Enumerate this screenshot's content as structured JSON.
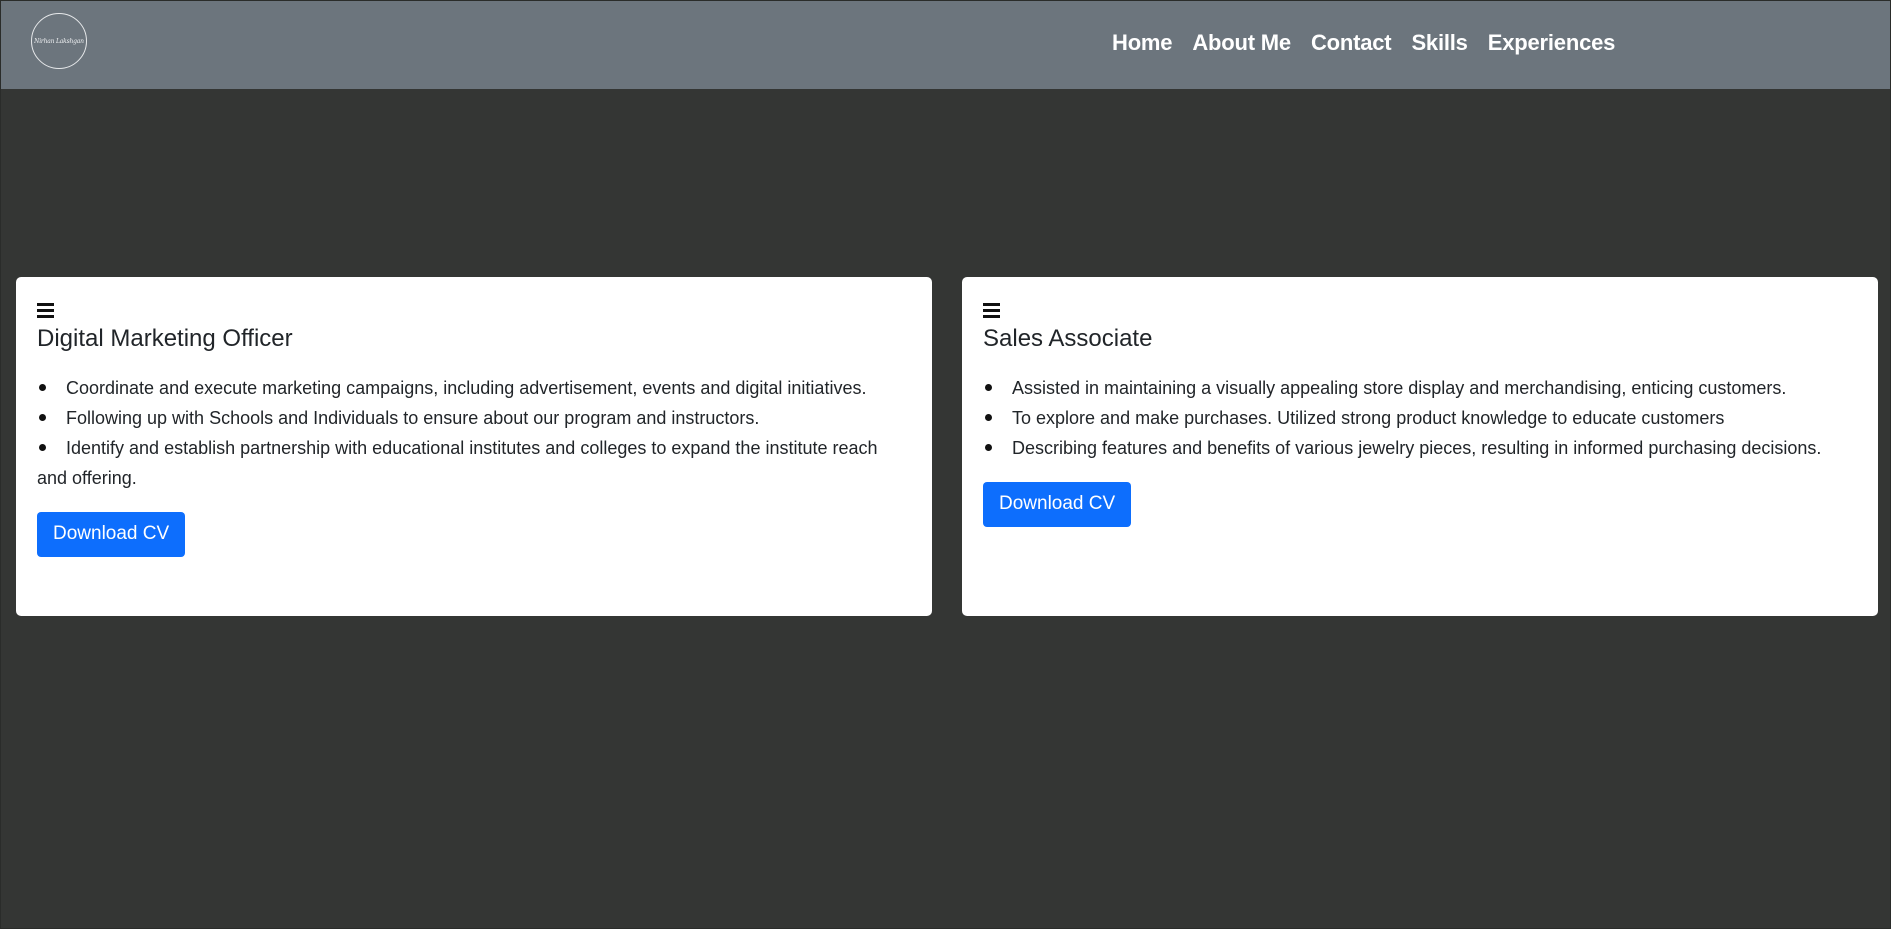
{
  "navbar": {
    "logo_text": "Nirhan Lakshgan",
    "links": [
      "Home",
      "About Me",
      "Contact",
      "Skills",
      "Experiences"
    ]
  },
  "experiences": [
    {
      "title": "Digital Marketing Officer",
      "duties": [
        "Coordinate and execute marketing campaigns, including advertisement, events and digital initiatives.",
        "Following up with Schools and Individuals to ensure about our program and instructors.",
        "Identify and establish partnership with educational institutes and colleges to expand the institute reach and offering."
      ],
      "button_label": "Download CV"
    },
    {
      "title": "Sales Associate",
      "duties": [
        "Assisted in maintaining a visually appealing store display and merchandising, enticing customers.",
        "To explore and make purchases. Utilized strong product knowledge to educate customers",
        "Describing features and benefits of various jewelry pieces, resulting in informed purchasing decisions."
      ],
      "button_label": "Download CV"
    }
  ],
  "colors": {
    "navbar_bg": "#6c757d",
    "page_bg": "#343634",
    "button_bg": "#0d6efd"
  },
  "icons": {
    "card_icon": "menu-icon"
  }
}
